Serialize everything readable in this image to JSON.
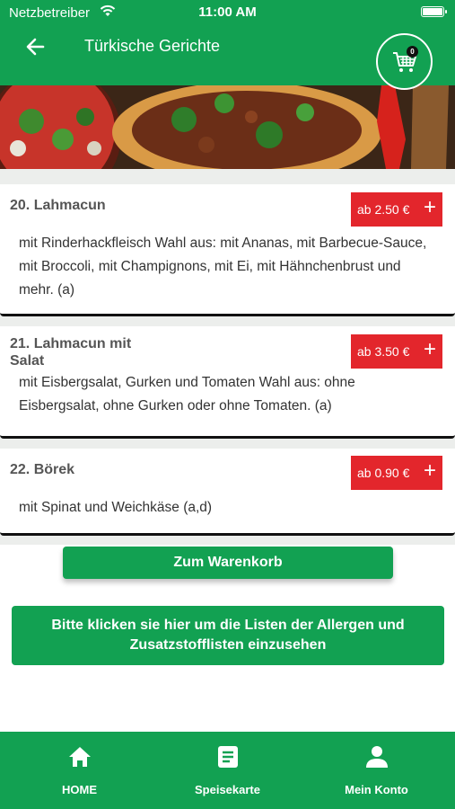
{
  "status_bar": {
    "carrier": "Netzbetreiber",
    "time": "11:00 AM",
    "icons": [
      "wifi-icon",
      "battery-icon"
    ]
  },
  "header": {
    "title": "Türkische Gerichte",
    "back_icon": "arrow-left-icon",
    "cart_icon": "shopping-cart-icon",
    "cart_count": "0"
  },
  "items": [
    {
      "name": "20. Lahmacun",
      "price": "ab 2.50 €",
      "add": "+",
      "description": "mit Rinderhackfleisch Wahl aus: mit Ananas, mit Barbecue-Sauce, mit Broccoli, mit Champignons, mit Ei, mit Hähnchenbrust und mehr. (a)"
    },
    {
      "name": "21. Lahmacun mit Salat",
      "price": "ab 3.50 €",
      "add": "+",
      "description": "mit Eisbergsalat, Gurken und Tomaten Wahl aus: ohne Eisbergsalat, ohne Gurken oder ohne Tomaten. (a)"
    },
    {
      "name": "22. Börek",
      "price": "ab 0.90 €",
      "add": "+",
      "description": "mit Spinat und Weichkäse (a,d)"
    }
  ],
  "actions": {
    "cart_button": "Zum Warenkorb",
    "allergen_button": "Bitte klicken sie hier um die Listen der Allergen und Zusatzstofflisten einzusehen"
  },
  "tabbar": [
    {
      "label": "HOME",
      "icon": "home-icon"
    },
    {
      "label": "Speisekarte",
      "icon": "menu-icon"
    },
    {
      "label": "Mein Konto",
      "icon": "user-icon"
    }
  ],
  "colors": {
    "primary": "#12a152",
    "price": "#e3262c"
  }
}
